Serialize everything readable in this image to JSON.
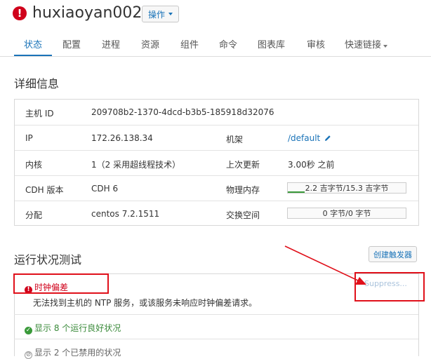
{
  "header": {
    "host_name": "huxiaoyan002",
    "action_button": "操作"
  },
  "tabs": [
    {
      "label": "状态"
    },
    {
      "label": "配置"
    },
    {
      "label": "进程"
    },
    {
      "label": "资源"
    },
    {
      "label": "组件"
    },
    {
      "label": "命令"
    },
    {
      "label": "图表库"
    },
    {
      "label": "审核"
    },
    {
      "label": "快速链接"
    }
  ],
  "details": {
    "title": "详细信息",
    "host_id_label": "主机 ID",
    "host_id_value": "209708b2-1370-4dcd-b3b5-185918d32076",
    "ip_label": "IP",
    "ip_value": "172.26.138.34",
    "rack_label": "机架",
    "rack_value": "/default",
    "cores_label": "内核",
    "cores_value": "1（2 采用超线程技术）",
    "last_update_label": "上次更新",
    "last_update_value": "3.00秒 之前",
    "cdh_label": "CDH 版本",
    "cdh_value": "CDH 6",
    "memory_label": "物理内存",
    "memory_value": "2.2 吉字节/15.3 吉字节",
    "memory_fraction": 0.144,
    "distribution_label": "分配",
    "distribution_value": "centos 7.2.1511",
    "swap_label": "交换空间",
    "swap_value": "0 字节/0 字节",
    "swap_fraction": 0
  },
  "health": {
    "title": "运行状况测试",
    "create_trigger": "创建触发器",
    "clock_offset_label": "时钟偏差",
    "clock_offset_message": "无法找到主机的 NTP 服务，或该服务未响应时钟偏差请求。",
    "suppress_label": "Suppress...",
    "good_link": "显示 8 个运行良好状况",
    "disabled_link": "显示 2 个已禁用的状况"
  },
  "colors": {
    "accent": "#1a73b8",
    "error": "#d0021b",
    "good": "#3a9a3a",
    "annotation_red": "#e0101a"
  }
}
